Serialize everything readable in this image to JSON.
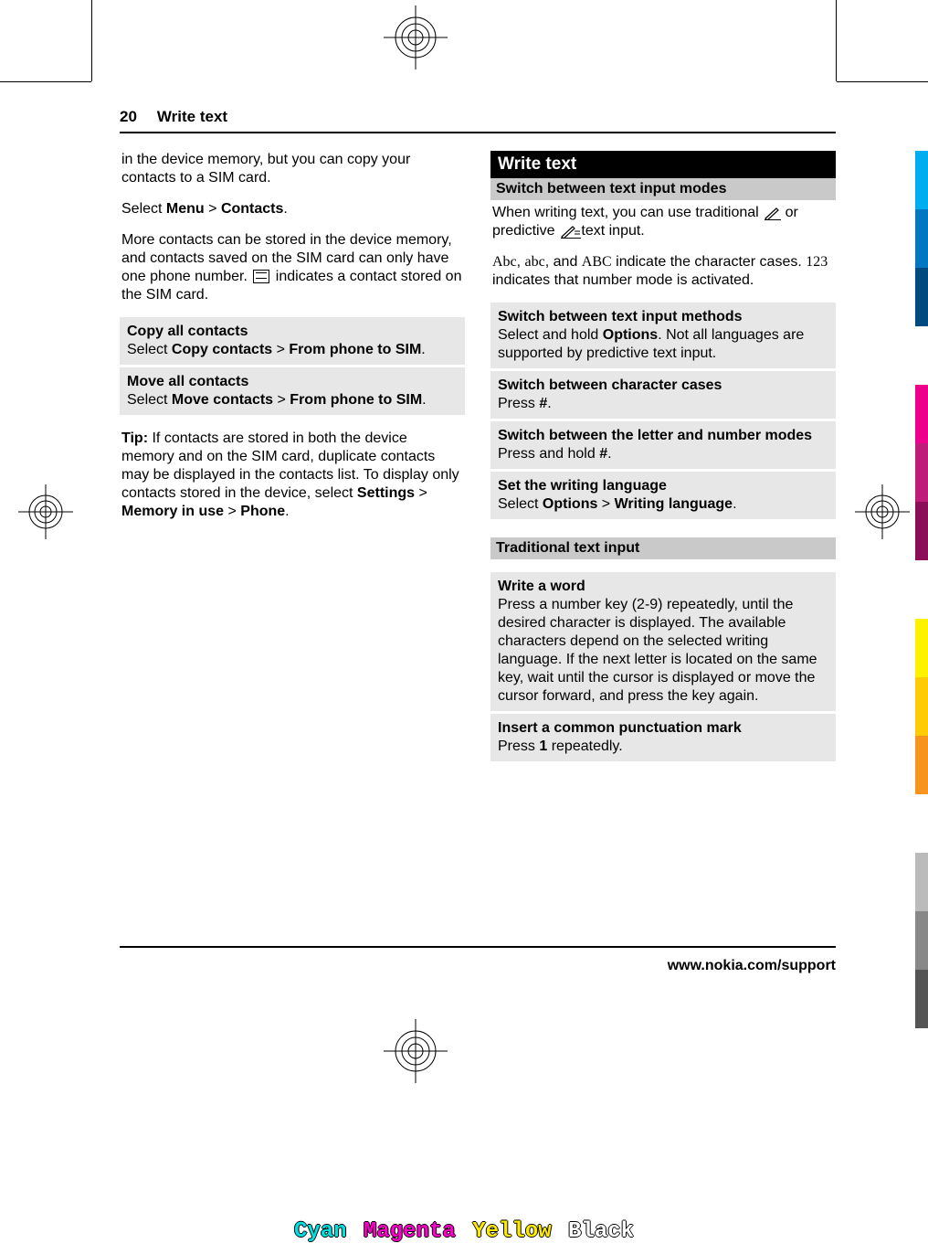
{
  "header": {
    "page_number": "20",
    "section_title": "Write text"
  },
  "col_left": {
    "p1": "in the device memory, but you can copy your contacts to a SIM card.",
    "p2_pre": "Select ",
    "p2_b1": "Menu",
    "p2_gt": " > ",
    "p2_b2": "Contacts",
    "p2_post": ".",
    "p3_a": "More contacts can be stored in the device memory, and contacts saved on the SIM card can only have one phone number. ",
    "p3_b": " indicates a contact stored on the SIM card.",
    "copy_hd": "Copy all contacts",
    "copy_pre": "Select ",
    "copy_b1": "Copy contacts",
    "copy_gt": " > ",
    "copy_b2": "From phone to SIM",
    "copy_post": ".",
    "move_hd": "Move all contacts",
    "move_pre": "Select ",
    "move_b1": "Move contacts",
    "move_gt": " > ",
    "move_b2": "From phone to SIM",
    "move_post": ".",
    "tip_hd": "Tip: ",
    "tip_a": "If contacts are stored in both the device memory and on the SIM card, duplicate contacts may be displayed in the contacts list. To display only contacts stored in the device, select ",
    "tip_b1": "Settings",
    "tip_gt": " > ",
    "tip_b2": "Memory in use",
    "tip_gt2": " > ",
    "tip_b3": "Phone",
    "tip_post": "."
  },
  "col_right": {
    "section_title": "Write text",
    "switch_modes_hd": "Switch between text input modes",
    "switch_modes_a": "When writing text, you can use traditional ",
    "switch_modes_b": " or predictive ",
    "switch_modes_c": " text input.",
    "cases_a_abc1": "Abc",
    "cases_a_sep1": ", ",
    "cases_a_abc2": "abc",
    "cases_a_mid": ", and ",
    "cases_a_abc3": "ABC",
    "cases_a_txt": " indicate the character cases. ",
    "cases_a_123": "123",
    "cases_a_txt2": " indicates that number mode is activated.",
    "methods_hd": "Switch between text input methods",
    "methods_a": "Select and hold ",
    "methods_b": "Options",
    "methods_c": ". Not all languages are supported by predictive text input.",
    "char_hd": "Switch between character cases",
    "char_a": "Press ",
    "char_b": "#",
    "char_c": ".",
    "letnum_hd": "Switch between the letter and number modes",
    "letnum_a": "Press and hold ",
    "letnum_b": "#",
    "letnum_c": ".",
    "lang_hd": "Set the writing language",
    "lang_a": "Select ",
    "lang_b1": "Options",
    "lang_gt": " > ",
    "lang_b2": "Writing language",
    "lang_c": ".",
    "trad_hd": "Traditional text input",
    "word_hd": "Write a word",
    "word_txt": "Press a number key (2-9) repeatedly, until the desired character is displayed. The available characters depend on the selected writing language. If the next letter is located on the same key, wait until the cursor is displayed or move the cursor forward, and press the key again.",
    "punct_hd": "Insert a common punctuation mark",
    "punct_a": "Press ",
    "punct_b": "1",
    "punct_c": " repeatedly."
  },
  "footer": {
    "url": "www.nokia.com/support"
  },
  "color_bar": [
    "#00aeef",
    "#0077c0",
    "#004a80",
    "#ec008c",
    "#be1e7a",
    "#8a0f58",
    "#fff200",
    "#ffcb05",
    "#f7941d",
    "#bbbbbb",
    "#888888",
    "#555555"
  ],
  "color_names": {
    "c": "Cyan",
    "m": "Magenta",
    "y": "Yellow",
    "k": "Black"
  }
}
